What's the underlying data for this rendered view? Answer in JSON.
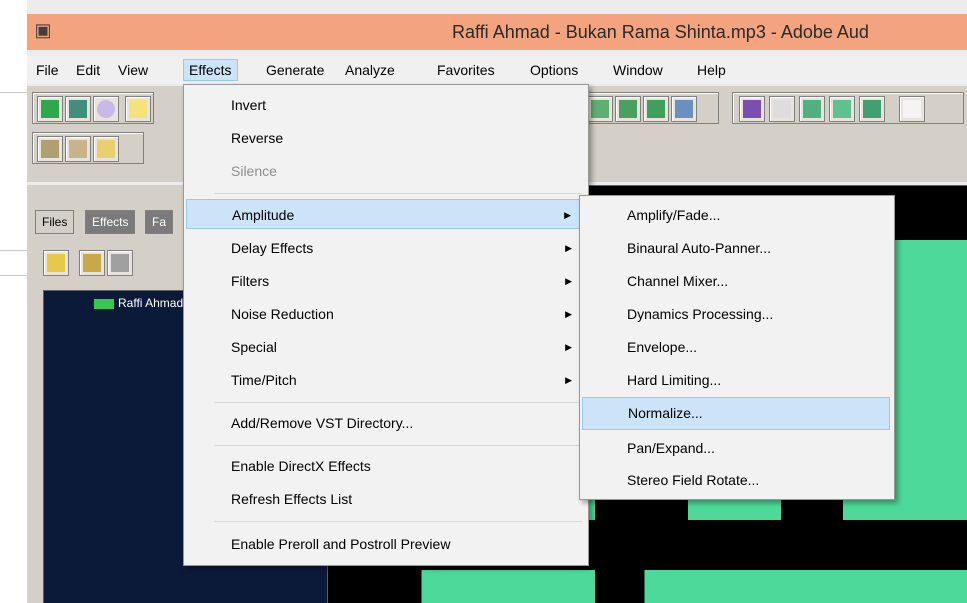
{
  "window": {
    "title": "Raffi Ahmad - Bukan Rama Shinta.mp3 - Adobe Aud"
  },
  "menubar": {
    "items": [
      "File",
      "Edit",
      "View",
      "Effects",
      "Generate",
      "Analyze",
      "Favorites",
      "Options",
      "Window",
      "Help"
    ]
  },
  "panel": {
    "tabs": [
      "Files",
      "Effects",
      "Fa"
    ],
    "file_name": "Raffi Ahmad"
  },
  "effects_menu": {
    "items": [
      {
        "label": "Invert"
      },
      {
        "label": "Reverse"
      },
      {
        "label": "Silence",
        "disabled": true
      },
      {
        "label": "Amplitude",
        "submenu": true,
        "highlighted": true
      },
      {
        "label": "Delay Effects",
        "submenu": true
      },
      {
        "label": "Filters",
        "submenu": true
      },
      {
        "label": "Noise Reduction",
        "submenu": true
      },
      {
        "label": "Special",
        "submenu": true
      },
      {
        "label": "Time/Pitch",
        "submenu": true
      },
      {
        "label": "Add/Remove VST Directory..."
      },
      {
        "label": "Enable DirectX Effects"
      },
      {
        "label": "Refresh Effects List"
      },
      {
        "label": "Enable Preroll and Postroll Preview"
      }
    ]
  },
  "amplitude_menu": {
    "items": [
      {
        "label": "Amplify/Fade..."
      },
      {
        "label": "Binaural Auto-Panner..."
      },
      {
        "label": "Channel Mixer..."
      },
      {
        "label": "Dynamics Processing..."
      },
      {
        "label": "Envelope..."
      },
      {
        "label": "Hard Limiting..."
      },
      {
        "label": "Normalize...",
        "highlighted": true
      },
      {
        "label": "Pan/Expand..."
      },
      {
        "label": "Stereo Field Rotate..."
      }
    ]
  },
  "icons": {
    "submenu_arrow": "triangle-right-icon"
  },
  "colors": {
    "title_bar": "#f3a47e",
    "highlight": "#cce4f7",
    "waveform": "#4dd99a"
  }
}
